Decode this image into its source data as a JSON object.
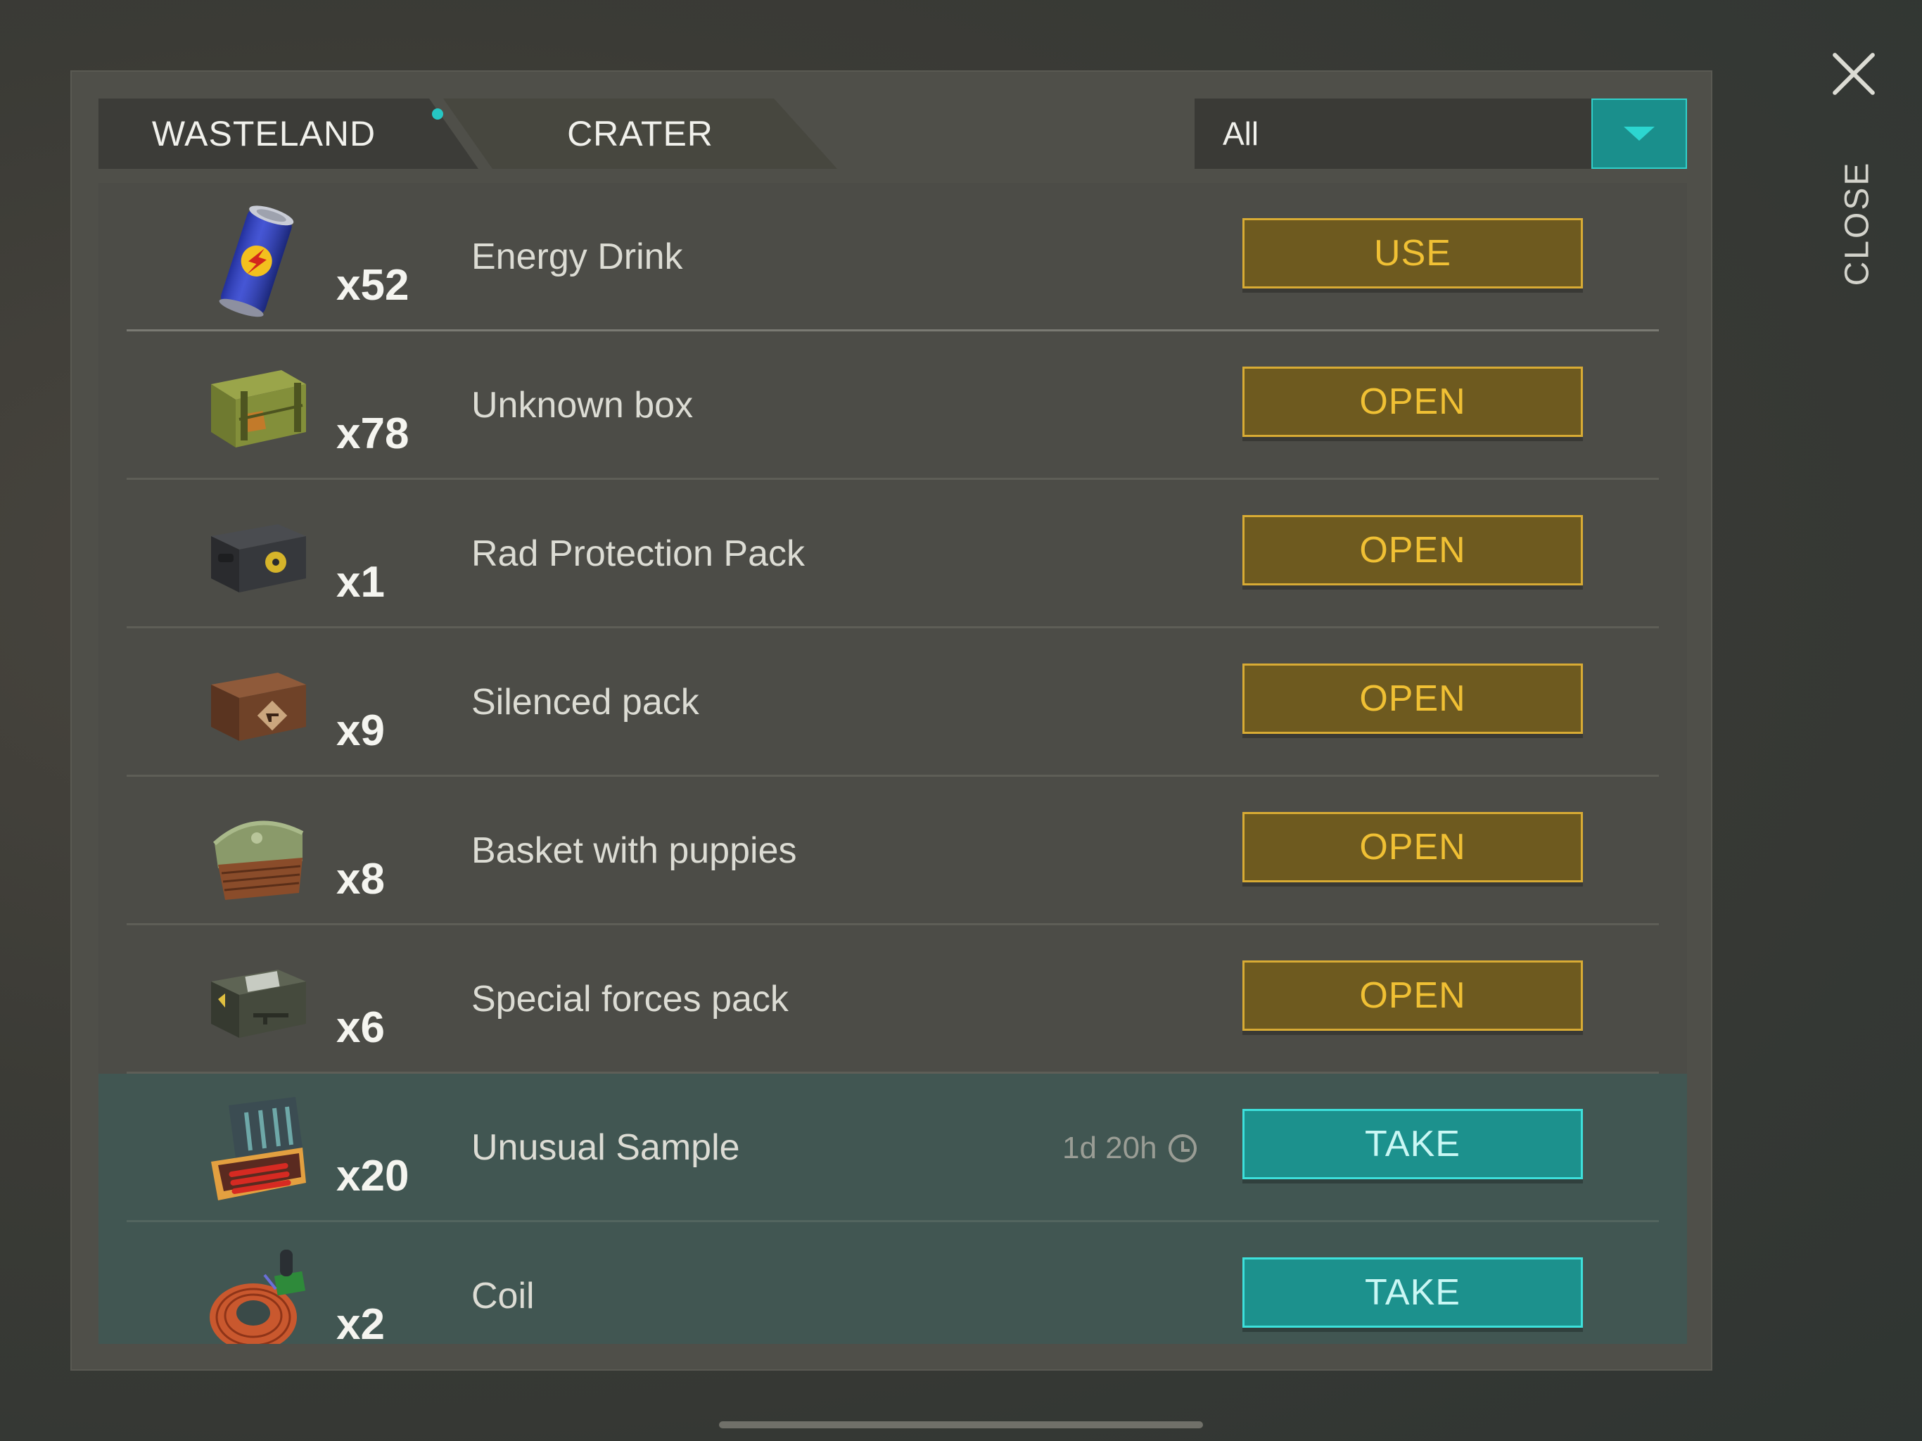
{
  "tabs": [
    {
      "label": "WASTELAND",
      "active": true,
      "notification": true
    },
    {
      "label": "CRATER",
      "active": false
    }
  ],
  "filter": {
    "value": "All",
    "icon": "dropdown-triangle-icon"
  },
  "close": {
    "label": "CLOSE",
    "icon": "close-x-icon"
  },
  "colors": {
    "accent_teal": "#1c918d",
    "button_gold": "#6e5a1f",
    "button_gold_text": "#f0c034"
  },
  "items": [
    {
      "name": "Energy Drink",
      "qty": "x52",
      "button": "USE",
      "icon": "energy-drink-can-icon"
    },
    {
      "name": "Unknown box",
      "qty": "x78",
      "button": "OPEN",
      "icon": "green-crate-icon"
    },
    {
      "name": "Rad Protection Pack",
      "qty": "x1",
      "button": "OPEN",
      "icon": "black-rad-case-icon"
    },
    {
      "name": "Silenced pack",
      "qty": "x9",
      "button": "OPEN",
      "icon": "brown-crate-icon"
    },
    {
      "name": "Basket with puppies",
      "qty": "x8",
      "button": "OPEN",
      "icon": "puppy-basket-icon"
    },
    {
      "name": "Special forces pack",
      "qty": "x6",
      "button": "OPEN",
      "icon": "military-case-icon"
    },
    {
      "name": "Unusual Sample",
      "qty": "x20",
      "button": "TAKE",
      "timer": "1d 20h",
      "icon": "sample-case-icon"
    },
    {
      "name": "Coil",
      "qty": "x2",
      "button": "TAKE",
      "icon": "copper-coil-icon"
    }
  ]
}
